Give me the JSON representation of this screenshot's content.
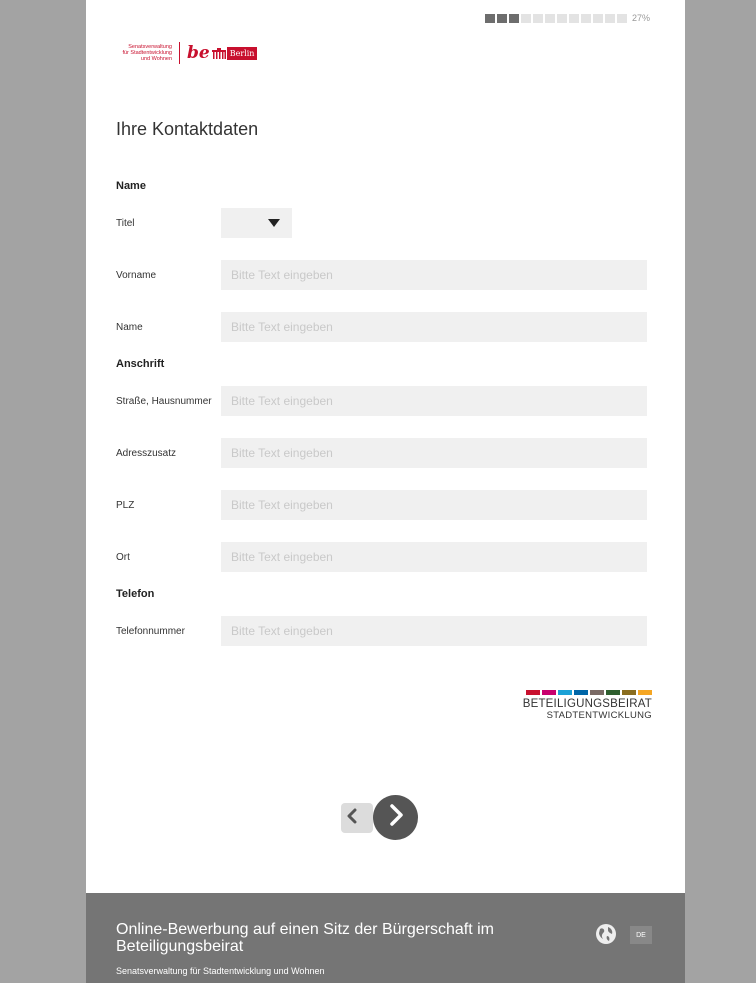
{
  "progress": {
    "percent_label": "27%",
    "filled_segments": 3,
    "total_segments": 12
  },
  "logo": {
    "senat_lines": [
      "Senatsverwaltung",
      "für Stadtentwicklung",
      "und Wohnen"
    ],
    "be": "be",
    "berlin": "Berlin"
  },
  "form": {
    "title": "Ihre Kontaktdaten",
    "sections": {
      "name": "Name",
      "anschrift": "Anschrift",
      "telefon": "Telefon"
    },
    "fields": {
      "titel_label": "Titel",
      "vorname_label": "Vorname",
      "name_label": "Name",
      "strasse_label": "Straße, Hausnummer",
      "adresszusatz_label": "Adresszusatz",
      "plz_label": "PLZ",
      "ort_label": "Ort",
      "telefonnummer_label": "Telefonnummer",
      "placeholder": "Bitte Text eingeben"
    }
  },
  "brand_logo": {
    "line1": "BETEILIGUNGSBEIRAT",
    "line2": "STADTENTWICKLUNG",
    "colors": [
      "#c8102e",
      "#c8006e",
      "#1ba1d6",
      "#0066a8",
      "#7a6a65",
      "#2e5e2e",
      "#8a6d1f",
      "#f5a623"
    ]
  },
  "footer": {
    "title": "Online-Bewerbung auf einen Sitz der Bürgerschaft im Beteiligungsbeirat",
    "subtitle": "Senatsverwaltung für Stadtentwicklung und Wohnen",
    "language": "DE"
  }
}
